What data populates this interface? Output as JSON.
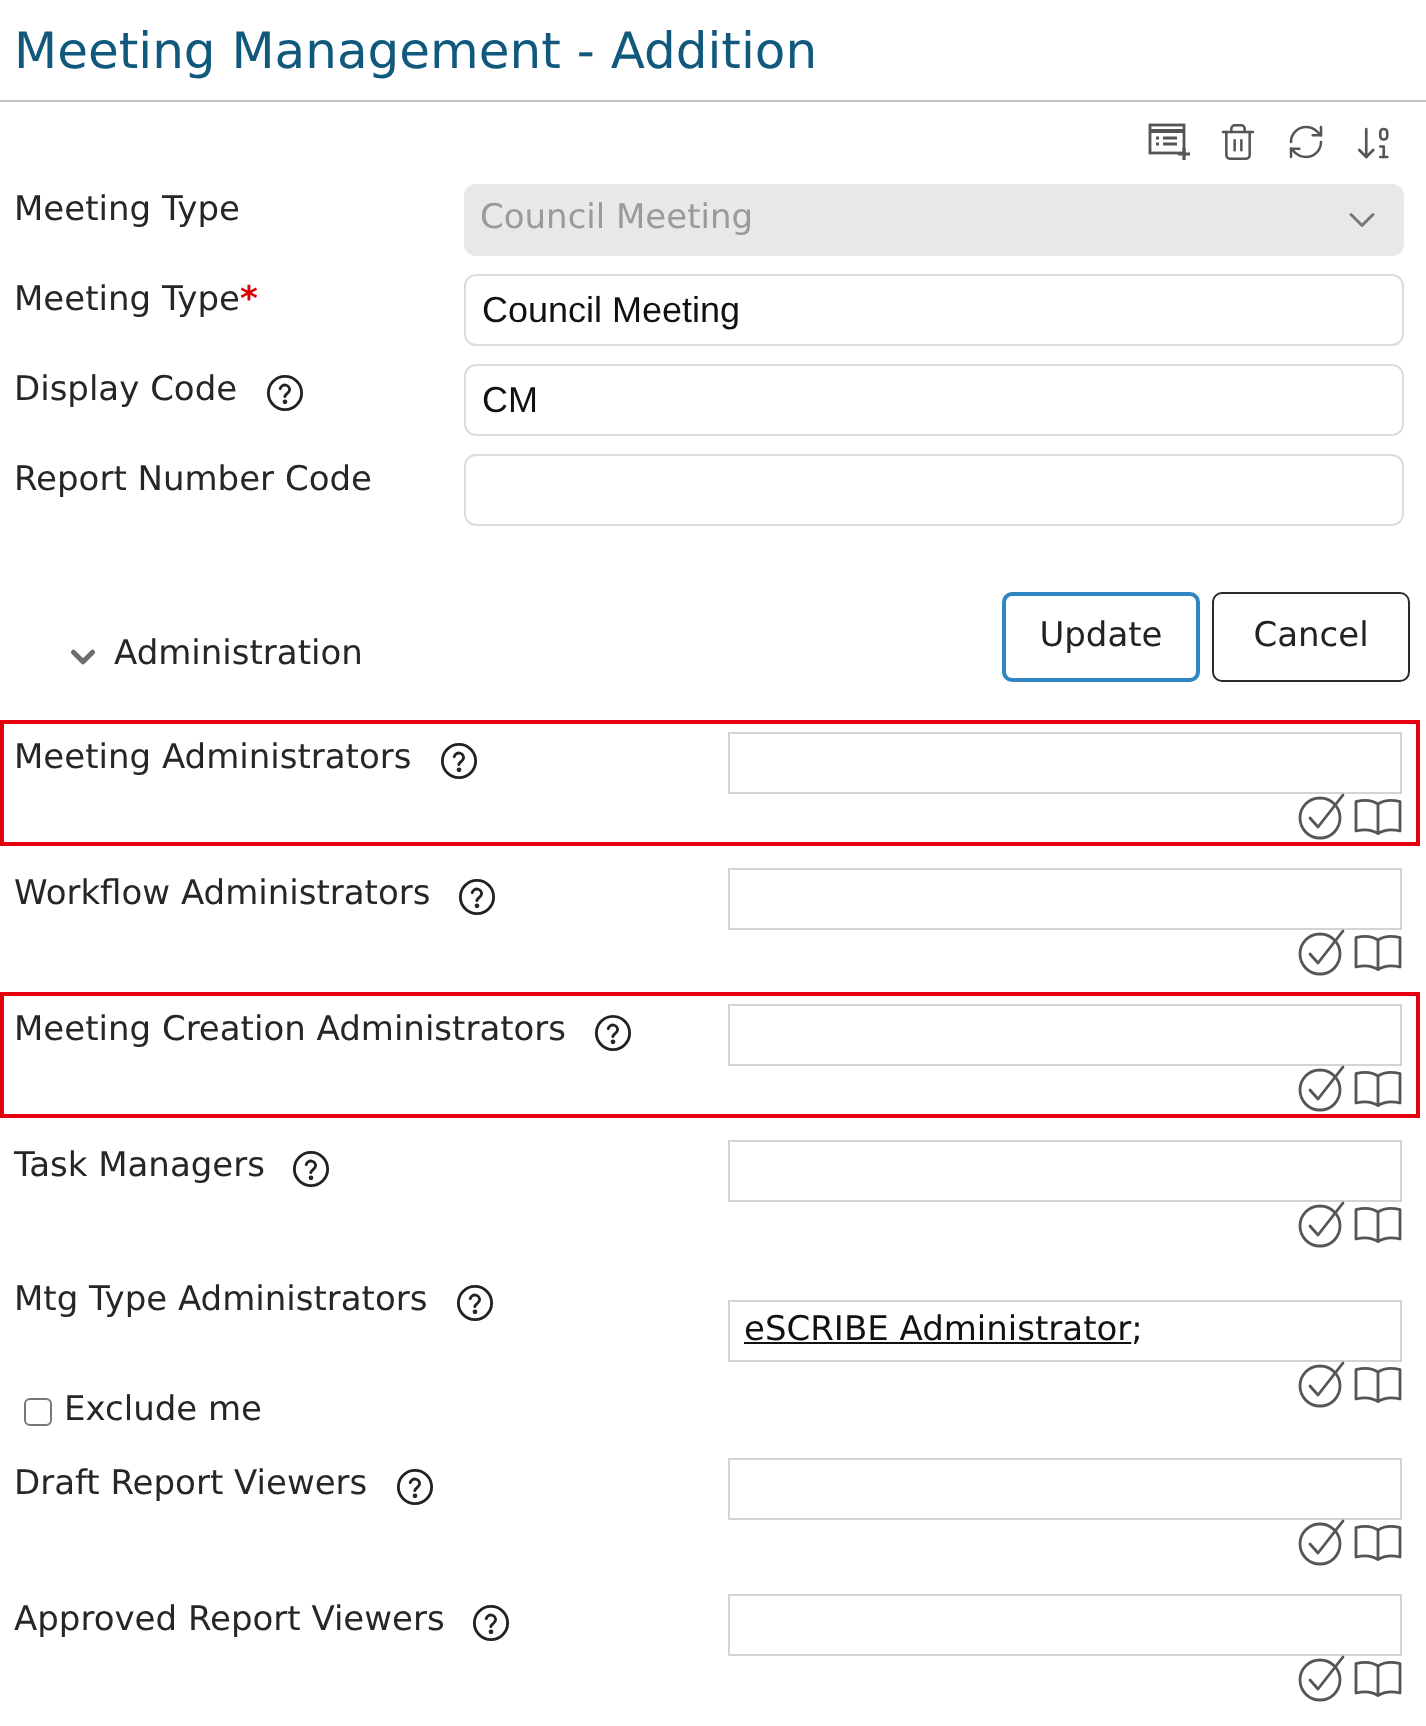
{
  "header": {
    "title": "Meeting Management - Addition"
  },
  "general": {
    "fields": [
      {
        "kind": "select",
        "label": "Meeting Type",
        "value": "Council Meeting",
        "disabled": true
      },
      {
        "kind": "text",
        "label": "Meeting Type",
        "required_mark": "*",
        "value": "Council Meeting",
        "disabled": false
      },
      {
        "kind": "text",
        "label": "Display Code",
        "value": "CM",
        "disabled": false,
        "help": true
      },
      {
        "kind": "text",
        "label": "Report Number Code",
        "disabled": false
      }
    ]
  },
  "actions": [
    {
      "label": "Update",
      "focused": true
    },
    {
      "label": "Cancel",
      "focused": false
    }
  ],
  "administration": {
    "title": "Administration",
    "expanded": true,
    "fields": [
      {
        "label": "Meeting Administrators",
        "help": true,
        "highlighted": true
      },
      {
        "label": "Workflow Administrators",
        "help": true
      },
      {
        "label": "Meeting Creation Administrators",
        "help": true,
        "highlighted": true
      },
      {
        "label": "Task Managers",
        "help": true
      },
      {
        "label": "Mtg Type Administrators",
        "help": true,
        "entries": [
          {
            "name": "eSCRIBE Administrator",
            "separator": ";"
          }
        ],
        "option": {
          "label": "Exclude me",
          "checked": false
        }
      },
      {
        "label": "Draft Report Viewers",
        "help": true
      },
      {
        "label": "Approved Report Viewers",
        "help": true
      }
    ]
  }
}
